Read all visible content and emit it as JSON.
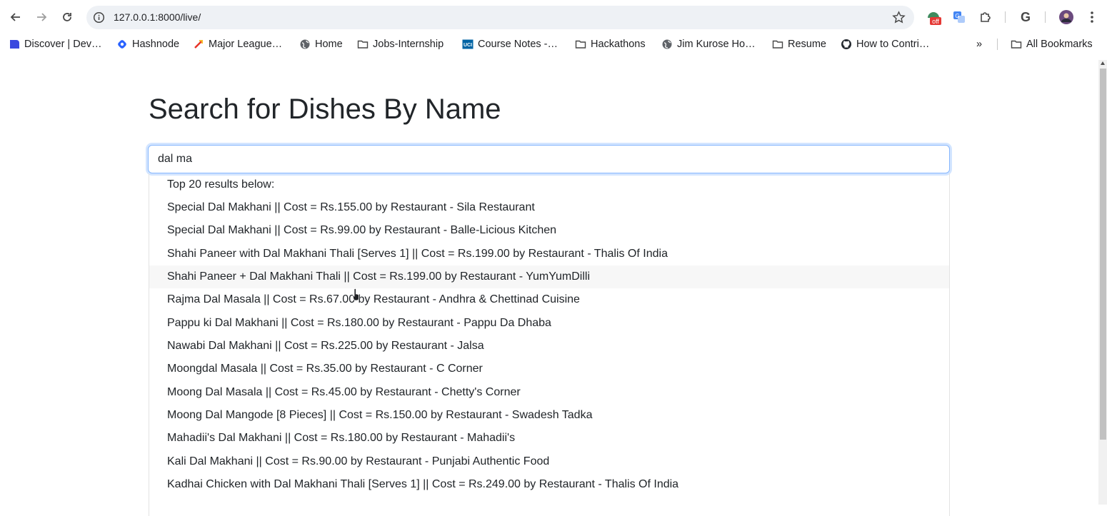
{
  "browser": {
    "url": "127.0.0.1:8000/live/",
    "bookmarks": [
      {
        "label": "Discover | Dev…",
        "icon": "dev-icon"
      },
      {
        "label": "Hashnode",
        "icon": "hashnode-icon"
      },
      {
        "label": "Major League…",
        "icon": "mlh-icon"
      },
      {
        "label": "Home",
        "icon": "globe-icon"
      },
      {
        "label": "Jobs-Internship",
        "icon": "folder-icon"
      },
      {
        "label": "Course Notes -…",
        "icon": "uci-icon"
      },
      {
        "label": "Hackathons",
        "icon": "folder-icon"
      },
      {
        "label": "Jim Kurose Ho…",
        "icon": "globe-icon"
      },
      {
        "label": "Resume",
        "icon": "folder-icon"
      },
      {
        "label": "How to Contri…",
        "icon": "github-icon"
      }
    ],
    "overflow": "»",
    "all_bookmarks": "All Bookmarks",
    "extension_badge": "off"
  },
  "page": {
    "title": "Search for Dishes By Name",
    "search_value": "dal ma",
    "results_header": "Top 20 results below:",
    "results": [
      "Special Dal Makhani || Cost = Rs.155.00 by Restaurant - Sila Restaurant",
      "Special Dal Makhani || Cost = Rs.99.00 by Restaurant - Balle-Licious Kitchen",
      "Shahi Paneer with Dal Makhani Thali [Serves 1] || Cost = Rs.199.00 by Restaurant - Thalis Of India",
      "Shahi Paneer + Dal Makhani Thali || Cost = Rs.199.00 by Restaurant - YumYumDilli",
      "Rajma Dal Masala || Cost = Rs.67.00 by Restaurant - Andhra & Chettinad Cuisine",
      "Pappu ki Dal Makhani || Cost = Rs.180.00 by Restaurant - Pappu Da Dhaba",
      "Nawabi Dal Makhani || Cost = Rs.225.00 by Restaurant - Jalsa",
      "Moongdal Masala || Cost = Rs.35.00 by Restaurant - C Corner",
      "Moong Dal Masala || Cost = Rs.45.00 by Restaurant - Chetty's Corner",
      "Moong Dal Mangode [8 Pieces] || Cost = Rs.150.00 by Restaurant - Swadesh Tadka",
      "Mahadii's Dal Makhani || Cost = Rs.180.00 by Restaurant - Mahadii's",
      "Kali Dal Makhani || Cost = Rs.90.00 by Restaurant - Punjabi Authentic Food",
      "Kadhai Chicken with Dal Makhani Thali [Serves 1] || Cost = Rs.249.00 by Restaurant - Thalis Of India"
    ]
  }
}
